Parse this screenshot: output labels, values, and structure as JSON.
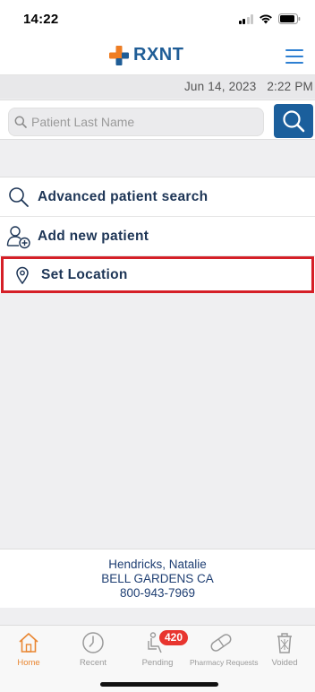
{
  "status_bar": {
    "time": "14:22"
  },
  "header": {
    "logo_text": "RXNT",
    "logo_color": "#1f5d96",
    "cross_colors": [
      "#1f5d96",
      "#ef7d22"
    ]
  },
  "date_bar": {
    "date": "Jun 14, 2023",
    "time": "2:22 PM"
  },
  "search": {
    "placeholder": "Patient Last Name",
    "value": ""
  },
  "actions": [
    {
      "label": "Advanced patient search",
      "icon": "search-icon"
    },
    {
      "label": "Add new patient",
      "icon": "add-person-icon"
    },
    {
      "label": "Set Location",
      "icon": "location-pin-icon",
      "highlighted": true
    }
  ],
  "location": {
    "name": "Hendricks, Natalie",
    "city": "BELL GARDENS CA",
    "phone": "800-943-7969"
  },
  "tabs": [
    {
      "label": "Home",
      "icon": "home-icon",
      "active": true
    },
    {
      "label": "Recent",
      "icon": "clock-icon",
      "active": false
    },
    {
      "label": "Pending",
      "icon": "pending-icon",
      "active": false,
      "badge": "420"
    },
    {
      "label": "Pharmacy Requests",
      "icon": "pill-icon",
      "active": false
    },
    {
      "label": "Voided",
      "icon": "trash-icon",
      "active": false
    }
  ],
  "colors": {
    "accent": "#1b5f9c",
    "active_tab": "#e98733",
    "badge": "#e8352f",
    "highlight_border": "#d51f27"
  }
}
